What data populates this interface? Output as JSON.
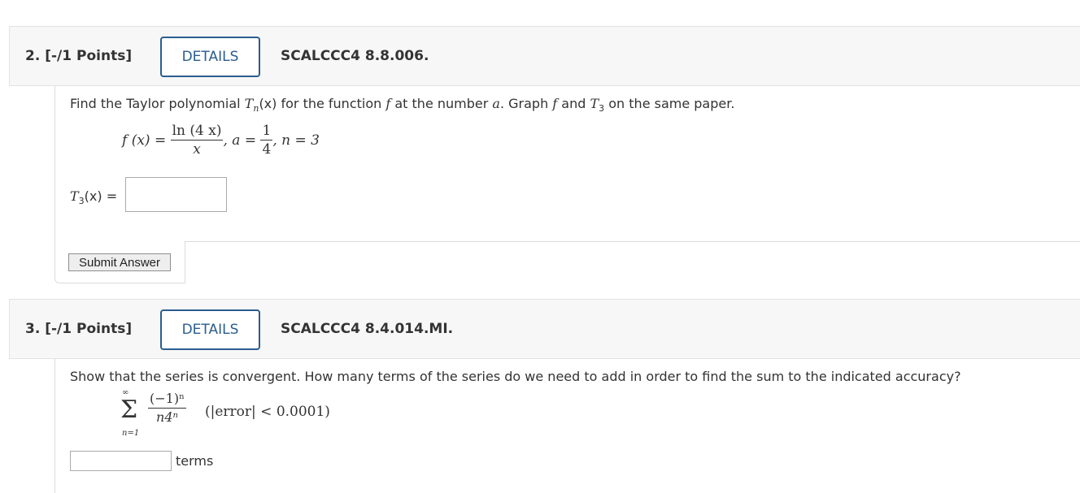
{
  "q2": {
    "number": "2.",
    "points": "[-/1 Points]",
    "details_label": "DETAILS",
    "code": "SCALCCC4 8.8.006.",
    "prompt_pre": "Find the Taylor polynomial ",
    "prompt_T": "T",
    "prompt_n": "n",
    "prompt_x": "(x)",
    "prompt_mid": " for the function ",
    "prompt_f": "f",
    "prompt_at": " at the number ",
    "prompt_a": "a",
    "prompt_graph": ". Graph ",
    "prompt_f2": "f",
    "prompt_and": " and ",
    "prompt_T2": "T",
    "prompt_3": "3",
    "prompt_end": " on the same paper.",
    "formula_lhs": "f (x) =",
    "formula_num": "ln (4 x)",
    "formula_den": "x",
    "formula_a": ", a =",
    "formula_anum": "1",
    "formula_aden": "4",
    "formula_n": ", n = 3",
    "answer_T": "T",
    "answer_sub": "3",
    "answer_x": "(x)",
    "answer_eq": "=",
    "answer_value": "",
    "submit_label": "Submit Answer"
  },
  "q3": {
    "number": "3.",
    "points": "[-/1 Points]",
    "details_label": "DETAILS",
    "code": "SCALCCC4 8.4.014.MI.",
    "prompt": "Show that the series is convergent. How many terms of the series do we need to add in order to find the sum to the indicated accuracy?",
    "sum_upper": "∞",
    "sum_symbol": "Σ",
    "sum_lower": "n=1",
    "term_num": "(−1)ⁿ",
    "term_den": "n4ⁿ",
    "accuracy": "(|error| < 0.0001)",
    "answer_value": "",
    "terms_label": "terms"
  }
}
